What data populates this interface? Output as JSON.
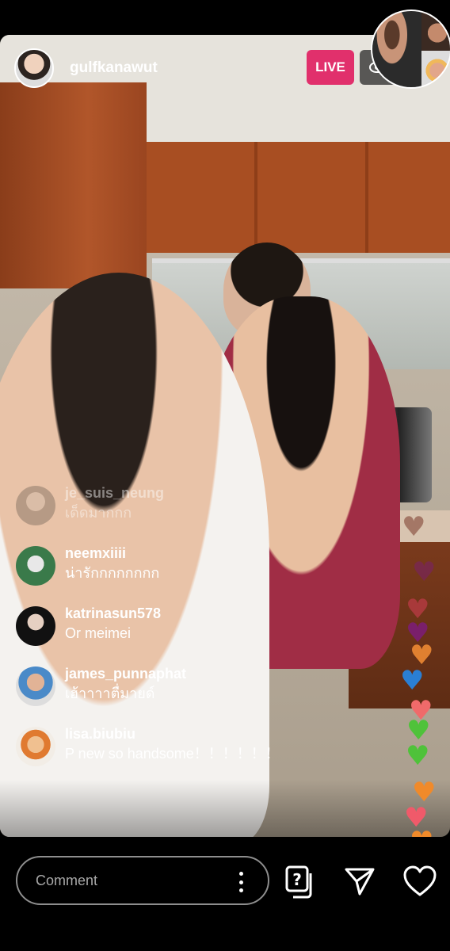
{
  "header": {
    "host_username": "gulfkanawut",
    "live_label": "LIVE",
    "viewer_icon": "eye-icon"
  },
  "comments": [
    {
      "user": "je_suis_neung",
      "text": "เด็ดมากกก",
      "faded": true
    },
    {
      "user": "neemxiiii",
      "text": "น่ารักกกกกกกก"
    },
    {
      "user": "katrinasun578",
      "text": "Or meimei"
    },
    {
      "user": "james_punnaphat",
      "text": "เฮ้าาาาตื่มายด์"
    },
    {
      "user": "lisa.biubiu",
      "text": "P new so handsome！！！！！！"
    }
  ],
  "hearts": [
    {
      "color": "#7a3a2a"
    },
    {
      "color": "#7a1f6b"
    },
    {
      "color": "#a8393a"
    },
    {
      "color": "#7a1f6b"
    },
    {
      "color": "#e08030"
    },
    {
      "color": "#2a7fd4"
    },
    {
      "color": "#f06a6a"
    },
    {
      "color": "#4fc23a"
    },
    {
      "color": "#4fc23a"
    },
    {
      "color": "#f08a2a"
    },
    {
      "color": "#f05a6a"
    },
    {
      "color": "#f08a2a"
    },
    {
      "color": "#b03a4a"
    }
  ],
  "bottom_bar": {
    "comment_placeholder": "Comment",
    "question_icon": "question-icon",
    "send_icon": "send-icon",
    "like_icon": "heart-icon"
  }
}
